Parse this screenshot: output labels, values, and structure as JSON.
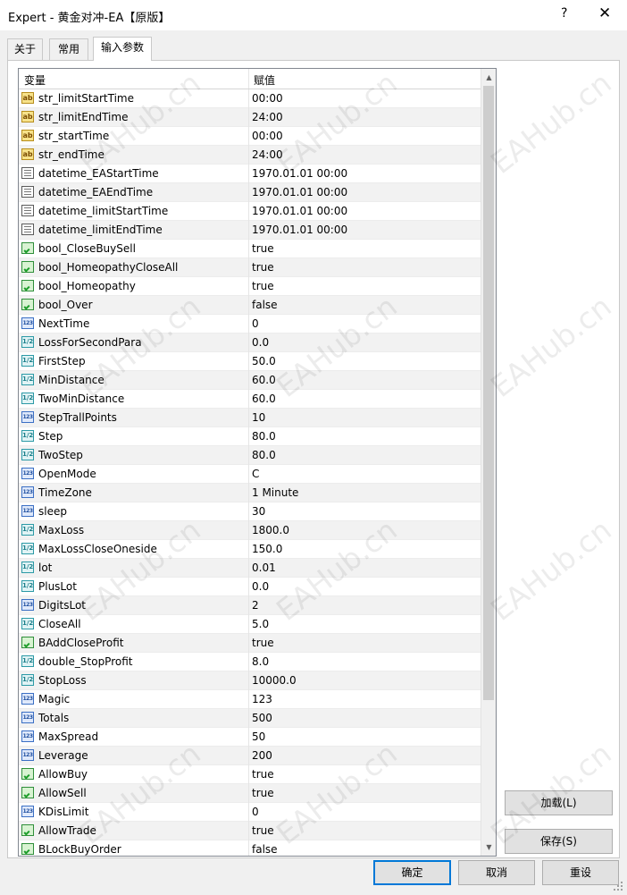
{
  "window": {
    "title": "Expert - 黄金对冲-EA【原版】",
    "help_label": "?",
    "close_label": "✕"
  },
  "tabs": [
    {
      "label": "关于"
    },
    {
      "label": "常用"
    },
    {
      "label": "输入参数"
    }
  ],
  "grid": {
    "col_variable": "变量",
    "col_value": "赋值",
    "rows": [
      {
        "name": "str_limitStartTime",
        "value": "00:00",
        "icon": "ab"
      },
      {
        "name": "str_limitEndTime",
        "value": "24:00",
        "icon": "ab"
      },
      {
        "name": "str_startTime",
        "value": "00:00",
        "icon": "ab"
      },
      {
        "name": "str_endTime",
        "value": "24:00",
        "icon": "ab"
      },
      {
        "name": "datetime_EAStartTime",
        "value": "1970.01.01 00:00",
        "icon": "dt"
      },
      {
        "name": "datetime_EAEndTime",
        "value": "1970.01.01 00:00",
        "icon": "dt"
      },
      {
        "name": "datetime_limitStartTime",
        "value": "1970.01.01 00:00",
        "icon": "dt"
      },
      {
        "name": "datetime_limitEndTime",
        "value": "1970.01.01 00:00",
        "icon": "dt"
      },
      {
        "name": "bool_CloseBuySell",
        "value": "true",
        "icon": "bool"
      },
      {
        "name": "bool_HomeopathyCloseAll",
        "value": "true",
        "icon": "bool"
      },
      {
        "name": "bool_Homeopathy",
        "value": "true",
        "icon": "bool"
      },
      {
        "name": "bool_Over",
        "value": "false",
        "icon": "bool"
      },
      {
        "name": "NextTime",
        "value": "0",
        "icon": "int"
      },
      {
        "name": "LossForSecondPara",
        "value": "0.0",
        "icon": "dbl"
      },
      {
        "name": "FirstStep",
        "value": "50.0",
        "icon": "dbl"
      },
      {
        "name": "MinDistance",
        "value": "60.0",
        "icon": "dbl"
      },
      {
        "name": "TwoMinDistance",
        "value": "60.0",
        "icon": "dbl"
      },
      {
        "name": "StepTrallPoints",
        "value": "10",
        "icon": "int"
      },
      {
        "name": "Step",
        "value": "80.0",
        "icon": "dbl"
      },
      {
        "name": "TwoStep",
        "value": "80.0",
        "icon": "dbl"
      },
      {
        "name": "OpenMode",
        "value": "C",
        "icon": "int"
      },
      {
        "name": "TimeZone",
        "value": "1 Minute",
        "icon": "int"
      },
      {
        "name": "sleep",
        "value": "30",
        "icon": "int"
      },
      {
        "name": "MaxLoss",
        "value": "1800.0",
        "icon": "dbl"
      },
      {
        "name": "MaxLossCloseOneside",
        "value": "150.0",
        "icon": "dbl"
      },
      {
        "name": "lot",
        "value": "0.01",
        "icon": "dbl"
      },
      {
        "name": "PlusLot",
        "value": "0.0",
        "icon": "dbl"
      },
      {
        "name": "DigitsLot",
        "value": "2",
        "icon": "int"
      },
      {
        "name": "CloseAll",
        "value": "5.0",
        "icon": "dbl"
      },
      {
        "name": "BAddCloseProfit",
        "value": "true",
        "icon": "bool"
      },
      {
        "name": "double_StopProfit",
        "value": "8.0",
        "icon": "dbl"
      },
      {
        "name": "StopLoss",
        "value": "10000.0",
        "icon": "dbl"
      },
      {
        "name": "Magic",
        "value": "123",
        "icon": "int"
      },
      {
        "name": "Totals",
        "value": "500",
        "icon": "int"
      },
      {
        "name": "MaxSpread",
        "value": "50",
        "icon": "int"
      },
      {
        "name": "Leverage",
        "value": "200",
        "icon": "int"
      },
      {
        "name": "AllowBuy",
        "value": "true",
        "icon": "bool"
      },
      {
        "name": "AllowSell",
        "value": "true",
        "icon": "bool"
      },
      {
        "name": "KDisLimit",
        "value": "0",
        "icon": "int"
      },
      {
        "name": "AllowTrade",
        "value": "true",
        "icon": "bool"
      },
      {
        "name": "BLockBuyOrder",
        "value": "false",
        "icon": "bool"
      }
    ]
  },
  "icon_glyphs": {
    "ab": "ab",
    "dt": "",
    "bool": "",
    "int": "123",
    "dbl": "1/2"
  },
  "side_buttons": {
    "load_label": "加载(L)",
    "save_label": "保存(S)"
  },
  "footer_buttons": {
    "ok_label": "确定",
    "cancel_label": "取消",
    "reset_label": "重设"
  },
  "watermark_text": "EAHub.cn",
  "colors": {
    "accent": "#0078d7",
    "grid_border": "#828790",
    "row_alt": "#f2f2f2"
  }
}
